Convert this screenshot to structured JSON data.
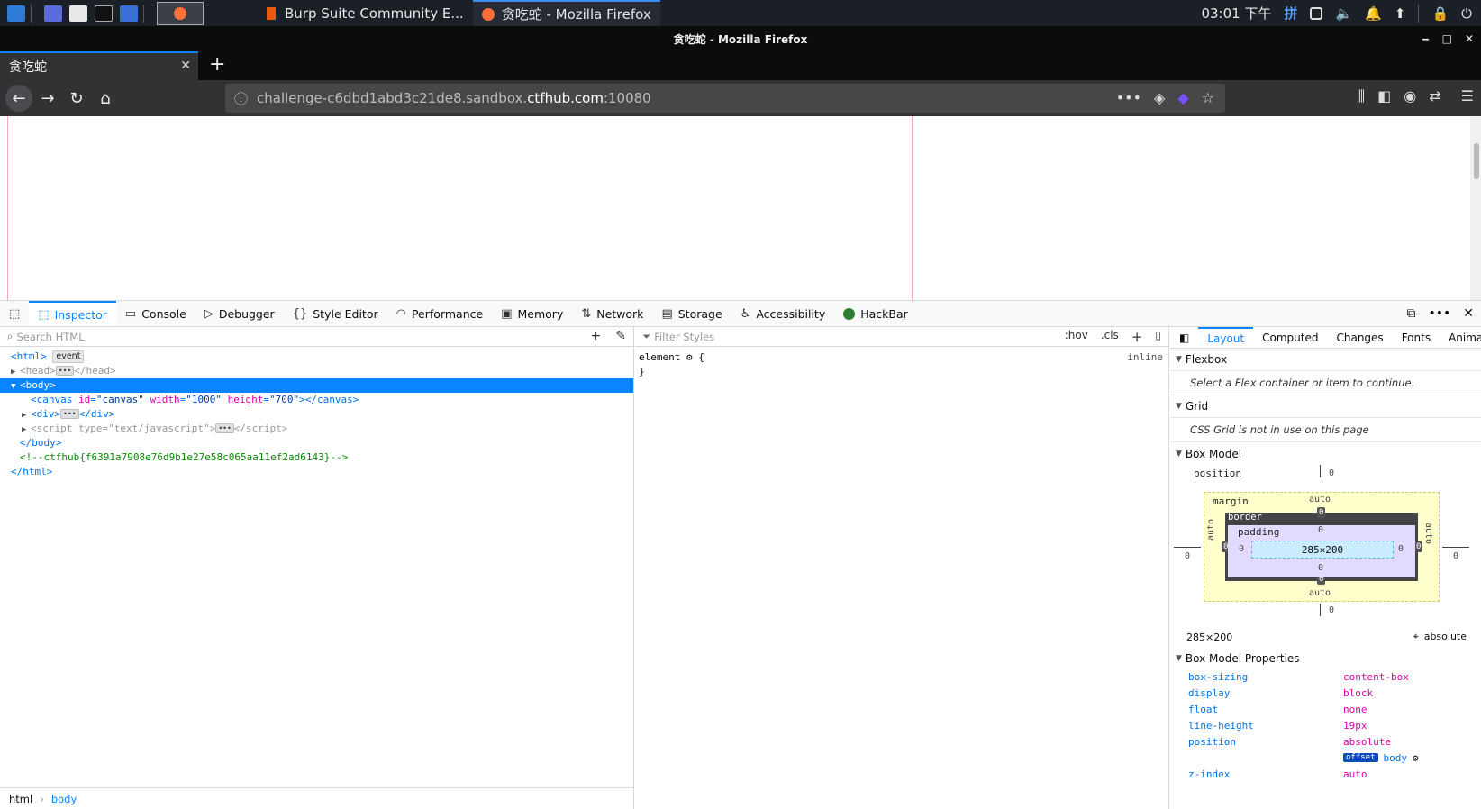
{
  "taskbar": {
    "windows": [
      "Burp Suite Community E...",
      "贪吃蛇 - Mozilla Firefox"
    ],
    "clock": "03:01 下午",
    "ime": "拼"
  },
  "firefox": {
    "title": "贪吃蛇 - Mozilla Firefox",
    "tab_title": "贪吃蛇",
    "url_prefix": "challenge-c6dbd1abd3c21de8.sandbox.",
    "url_host": "ctfhub.com",
    "url_suffix": ":10080"
  },
  "devtools": {
    "tabs": [
      "Inspector",
      "Console",
      "Debugger",
      "Style Editor",
      "Performance",
      "Memory",
      "Network",
      "Storage",
      "Accessibility",
      "HackBar"
    ],
    "search_placeholder": "Search HTML",
    "filter_placeholder": "Filter Styles",
    "hov": ":hov",
    "cls": ".cls",
    "tree": {
      "html_badge": "event",
      "canvas_id": "\"canvas\"",
      "canvas_width": "\"1000\"",
      "canvas_height": "\"700\"",
      "script_type": "\"text/javascript\"",
      "comment": "<!--ctfhub{f6391a7908e76d9b1e27e58c065aa11ef2ad6143}-->"
    },
    "breadcrumb": [
      "html",
      "body"
    ],
    "rule_selector": "element",
    "rule_source": "inline",
    "sidebar_tabs": [
      "Layout",
      "Computed",
      "Changes",
      "Fonts",
      "Animat"
    ],
    "flexbox_title": "Flexbox",
    "flexbox_msg": "Select a Flex container or item to continue.",
    "grid_title": "Grid",
    "grid_msg": "CSS Grid is not in use on this page",
    "boxmodel_title": "Box Model",
    "boxmodel": {
      "position_label": "position",
      "margin_label": "margin",
      "border_label": "border",
      "padding_label": "padding",
      "content_size": "285×200",
      "zero": "0",
      "auto": "auto"
    },
    "box_size": "285×200",
    "box_position": "absolute",
    "props_title": "Box Model Properties",
    "props": [
      {
        "name": "box-sizing",
        "value": "content-box"
      },
      {
        "name": "display",
        "value": "block"
      },
      {
        "name": "float",
        "value": "none"
      },
      {
        "name": "line-height",
        "value": "19px"
      },
      {
        "name": "position",
        "value": "absolute"
      },
      {
        "name": "z-index",
        "value": "auto"
      }
    ],
    "offset_badge": "offset",
    "offset_parent": "body"
  }
}
